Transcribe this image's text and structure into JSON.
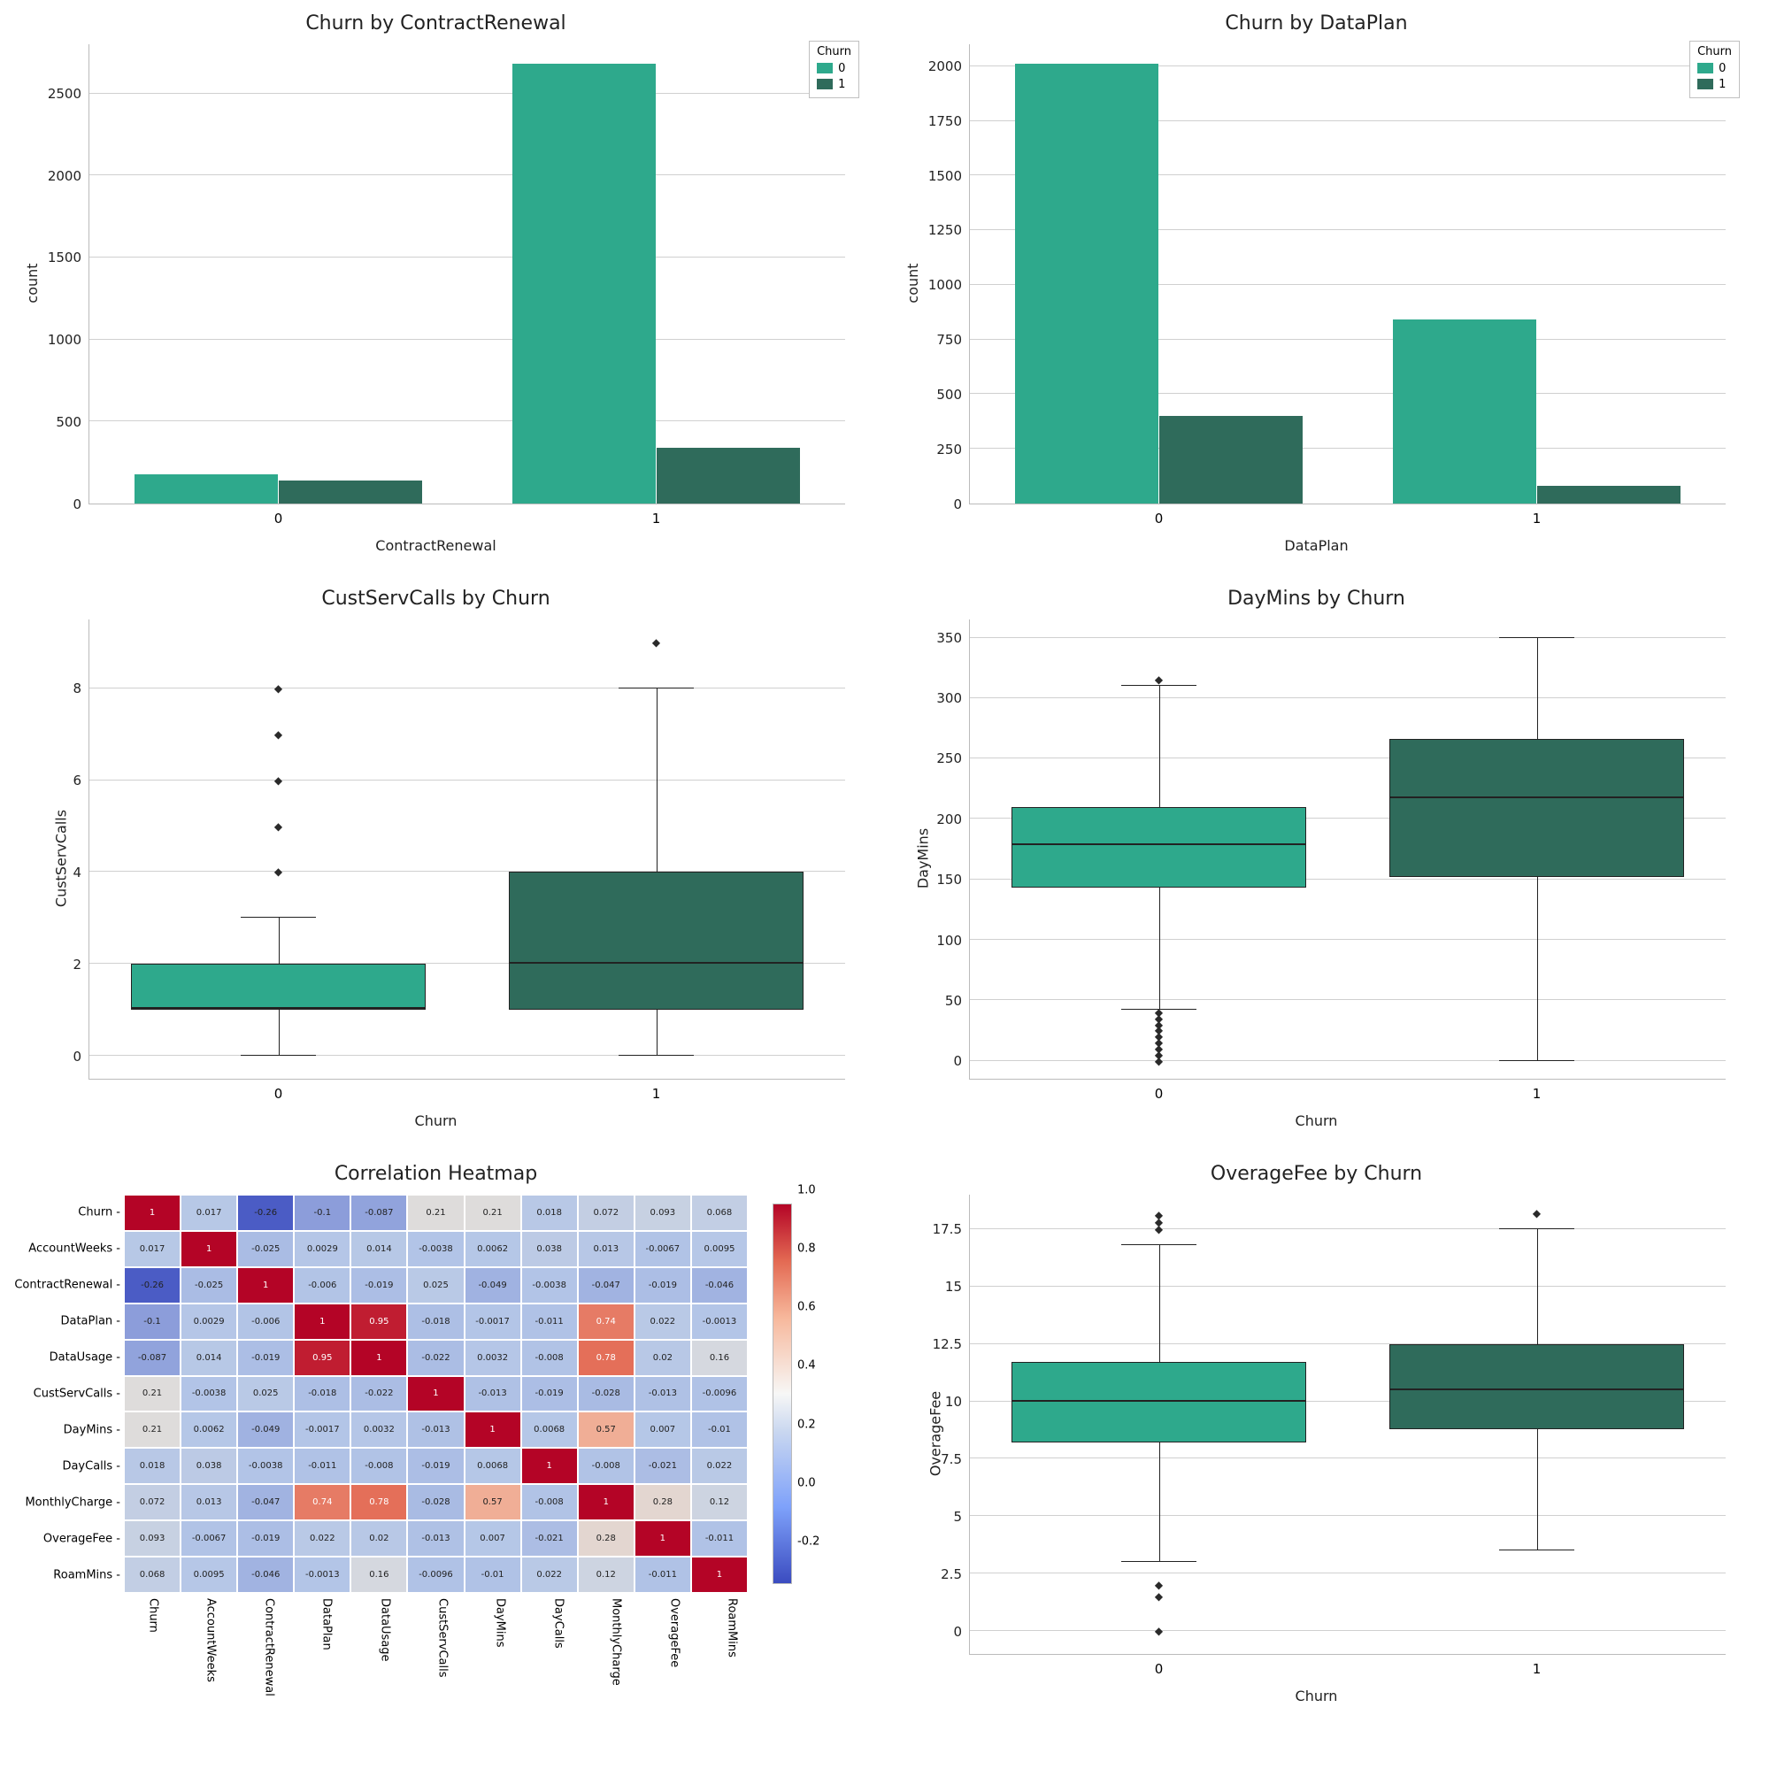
{
  "colors": {
    "c0": "#2ea98c",
    "c1": "#2f6b5b"
  },
  "chart_data": [
    {
      "id": "bar-contract",
      "type": "bar",
      "title": "Churn by ContractRenewal",
      "xlabel": "ContractRenewal",
      "ylabel": "count",
      "categories": [
        "0",
        "1"
      ],
      "series": [
        {
          "name": "0",
          "values": [
            180,
            2680
          ]
        },
        {
          "name": "1",
          "values": [
            140,
            340
          ]
        }
      ],
      "yticks": [
        0,
        500,
        1000,
        1500,
        2000,
        2500
      ],
      "ylim": [
        0,
        2800
      ],
      "legend": {
        "title": "Churn",
        "items": [
          "0",
          "1"
        ]
      }
    },
    {
      "id": "bar-dataplan",
      "type": "bar",
      "title": "Churn by DataPlan",
      "xlabel": "DataPlan",
      "ylabel": "count",
      "categories": [
        "0",
        "1"
      ],
      "series": [
        {
          "name": "0",
          "values": [
            2010,
            840
          ]
        },
        {
          "name": "1",
          "values": [
            400,
            80
          ]
        }
      ],
      "yticks": [
        0,
        250,
        500,
        750,
        1000,
        1250,
        1500,
        1750,
        2000
      ],
      "ylim": [
        0,
        2100
      ],
      "legend": {
        "title": "Churn",
        "items": [
          "0",
          "1"
        ]
      }
    },
    {
      "id": "box-custserv",
      "type": "box",
      "title": "CustServCalls by Churn",
      "xlabel": "Churn",
      "ylabel": "CustServCalls",
      "categories": [
        "0",
        "1"
      ],
      "boxes": [
        {
          "q1": 1,
          "median": 1,
          "q3": 2,
          "whisker_low": 0,
          "whisker_high": 3,
          "outliers": [
            4,
            5,
            6,
            7,
            8
          ]
        },
        {
          "q1": 1,
          "median": 2,
          "q3": 4,
          "whisker_low": 0,
          "whisker_high": 8,
          "outliers": [
            9
          ]
        }
      ],
      "yticks": [
        0,
        2,
        4,
        6,
        8
      ],
      "ylim": [
        -0.5,
        9.5
      ]
    },
    {
      "id": "box-daymins",
      "type": "box",
      "title": "DayMins by Churn",
      "xlabel": "Churn",
      "ylabel": "DayMins",
      "categories": [
        "0",
        "1"
      ],
      "boxes": [
        {
          "q1": 143,
          "median": 178,
          "q3": 210,
          "whisker_low": 42,
          "whisker_high": 310,
          "outliers": [
            0,
            5,
            10,
            15,
            20,
            25,
            30,
            35,
            40,
            315
          ]
        },
        {
          "q1": 152,
          "median": 217,
          "q3": 266,
          "whisker_low": 0,
          "whisker_high": 350,
          "outliers": []
        }
      ],
      "yticks": [
        0,
        50,
        100,
        150,
        200,
        250,
        300,
        350
      ],
      "ylim": [
        -15,
        365
      ]
    },
    {
      "id": "heatmap",
      "type": "heatmap",
      "title": "Correlation Heatmap",
      "labels": [
        "Churn",
        "AccountWeeks",
        "ContractRenewal",
        "DataPlan",
        "DataUsage",
        "CustServCalls",
        "DayMins",
        "DayCalls",
        "MonthlyCharge",
        "OverageFee",
        "RoamMins"
      ],
      "matrix": [
        [
          1,
          0.017,
          -0.26,
          -0.1,
          -0.087,
          0.21,
          0.21,
          0.018,
          0.072,
          0.093,
          0.068
        ],
        [
          0.017,
          1,
          -0.025,
          0.0029,
          0.014,
          -0.0038,
          0.0062,
          0.038,
          0.013,
          -0.0067,
          0.0095
        ],
        [
          -0.26,
          -0.025,
          1,
          -0.006,
          -0.019,
          0.025,
          -0.049,
          -0.0038,
          -0.047,
          -0.019,
          -0.046
        ],
        [
          -0.1,
          0.0029,
          -0.006,
          1,
          0.95,
          -0.018,
          -0.0017,
          -0.011,
          0.74,
          0.022,
          -0.0013
        ],
        [
          -0.087,
          0.014,
          -0.019,
          0.95,
          1,
          -0.022,
          0.0032,
          -0.008,
          0.78,
          0.02,
          0.16
        ],
        [
          0.21,
          -0.0038,
          0.025,
          -0.018,
          -0.022,
          1,
          -0.013,
          -0.019,
          -0.028,
          -0.013,
          -0.0096
        ],
        [
          0.21,
          0.0062,
          -0.049,
          -0.0017,
          0.0032,
          -0.013,
          1,
          0.0068,
          0.57,
          0.007,
          -0.01
        ],
        [
          0.018,
          0.038,
          -0.0038,
          -0.011,
          -0.008,
          -0.019,
          0.0068,
          1,
          -0.008,
          -0.021,
          0.022
        ],
        [
          0.072,
          0.013,
          -0.047,
          0.74,
          0.78,
          -0.028,
          0.57,
          -0.008,
          1,
          0.28,
          0.12
        ],
        [
          0.093,
          -0.0067,
          -0.019,
          0.022,
          0.02,
          -0.013,
          0.007,
          -0.021,
          0.28,
          1,
          -0.011
        ],
        [
          0.068,
          0.0095,
          -0.046,
          -0.0013,
          0.16,
          -0.0096,
          -0.01,
          0.022,
          0.12,
          -0.011,
          1
        ]
      ],
      "cbar_ticks": [
        -0.2,
        0.0,
        0.2,
        0.4,
        0.6,
        0.8,
        1.0
      ],
      "vmin": -0.3,
      "vmax": 1.0
    },
    {
      "id": "box-overage",
      "type": "box",
      "title": "OverageFee by Churn",
      "xlabel": "Churn",
      "ylabel": "OverageFee",
      "categories": [
        "0",
        "1"
      ],
      "boxes": [
        {
          "q1": 8.2,
          "median": 10.0,
          "q3": 11.7,
          "whisker_low": 3.0,
          "whisker_high": 16.8,
          "outliers": [
            0,
            1.5,
            2.0,
            17.5,
            17.8,
            18.1
          ]
        },
        {
          "q1": 8.8,
          "median": 10.5,
          "q3": 12.5,
          "whisker_low": 3.5,
          "whisker_high": 17.5,
          "outliers": [
            18.2
          ]
        }
      ],
      "yticks": [
        0.0,
        2.5,
        5.0,
        7.5,
        10.0,
        12.5,
        15.0,
        17.5
      ],
      "ylim": [
        -1,
        19
      ]
    }
  ]
}
